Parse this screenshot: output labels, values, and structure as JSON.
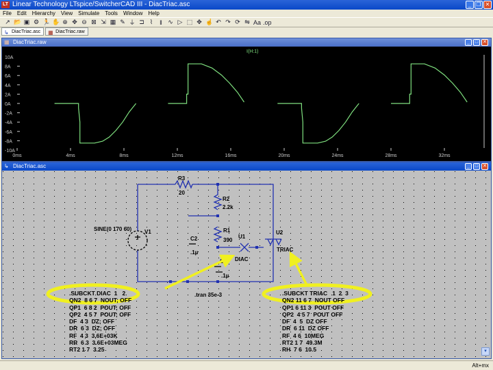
{
  "app": {
    "title": "Linear Technology LTspice/SwitcherCAD III - DiacTriac.asc",
    "icon_label": "LT",
    "window_buttons": [
      "_",
      "❐",
      "✕"
    ]
  },
  "menu": [
    "File",
    "Edit",
    "Hierarchy",
    "View",
    "Simulate",
    "Tools",
    "Window",
    "Help"
  ],
  "toolbar": [
    "new-schematic",
    "open",
    "save",
    "control-panel",
    "run",
    "halt",
    "zoom-in",
    "pan",
    "zoom-out",
    "zoom-fit",
    "autoscale",
    "grid",
    "wire",
    "ground",
    "label",
    "resistor",
    "capacitor",
    "inductor",
    "diode",
    "component",
    "move",
    "drag",
    "undo",
    "redo",
    "rotate",
    "mirror",
    "text",
    "spice-directive"
  ],
  "tabs": [
    {
      "label": "DiacTriac.asc",
      "icon": "schematic-icon",
      "active": true
    },
    {
      "label": "DiacTriac.raw",
      "icon": "waveform-icon",
      "active": false
    }
  ],
  "plot_window": {
    "title": "DiacTriac.raw"
  },
  "schematic_window": {
    "title": "DiacTriac.asc"
  },
  "chart_data": {
    "type": "line",
    "title": "",
    "legend": [
      "I(H:1)"
    ],
    "legend_placement": "top-center",
    "xlabel": "",
    "ylabel": "",
    "xlim": [
      0,
      32
    ],
    "ylim": [
      -10,
      10
    ],
    "x_ticks": [
      "0ms",
      "4ms",
      "8ms",
      "12ms",
      "16ms",
      "20ms",
      "24ms",
      "28ms",
      "32ms"
    ],
    "y_ticks": [
      "10A",
      "8A",
      "6A",
      "4A",
      "2A",
      "0A",
      "-2A",
      "-4A",
      "-6A",
      "-8A",
      "-10A"
    ],
    "color": "#7fe07f",
    "segments": [
      [
        [
          2.8,
          0
        ],
        [
          4.6,
          0
        ],
        [
          4.6,
          -1
        ],
        [
          4.7,
          -4
        ],
        [
          4.7,
          -8.5
        ],
        [
          5.8,
          -8.5
        ],
        [
          6.4,
          -8.1
        ],
        [
          6.9,
          -7.2
        ],
        [
          7.4,
          -5.8
        ],
        [
          7.9,
          -4
        ],
        [
          8.4,
          -1.8
        ],
        [
          8.9,
          0
        ]
      ],
      [
        [
          11.3,
          0
        ],
        [
          12.7,
          0
        ],
        [
          12.7,
          2
        ],
        [
          12.8,
          2
        ],
        [
          12.8,
          8.5
        ],
        [
          13.8,
          8.5
        ],
        [
          14.6,
          7.6
        ],
        [
          15.3,
          6.1
        ],
        [
          15.9,
          4.4
        ],
        [
          16.5,
          2.4
        ],
        [
          17.0,
          0.3
        ]
      ],
      [
        [
          19.5,
          0
        ],
        [
          21.3,
          0
        ],
        [
          21.3,
          -1
        ],
        [
          21.4,
          -4
        ],
        [
          21.4,
          -8.5
        ],
        [
          22.5,
          -8.5
        ],
        [
          23.1,
          -8.1
        ],
        [
          23.6,
          -7.2
        ],
        [
          24.1,
          -5.8
        ],
        [
          24.6,
          -4
        ],
        [
          25.1,
          -1.8
        ],
        [
          25.6,
          0
        ]
      ],
      [
        [
          28.0,
          0
        ],
        [
          29.4,
          0
        ],
        [
          29.4,
          2
        ],
        [
          29.5,
          2
        ],
        [
          29.5,
          8.5
        ],
        [
          30.5,
          8.5
        ],
        [
          31.3,
          7.6
        ],
        [
          32.0,
          6.1
        ],
        [
          32.6,
          4.4
        ],
        [
          33.2,
          2.4
        ],
        [
          33.7,
          0.3
        ]
      ]
    ]
  },
  "schematic": {
    "labels": {
      "r3": "R3",
      "r3_val": "20",
      "r2": "R2",
      "r2_val": "2.2k",
      "r1": "R1",
      "r1_val": "390",
      "c2": "C2",
      "c2_val": ".1µ",
      "c1": "C1",
      "c1_val": ".1µ",
      "v1": "V1",
      "v1_val": "SINE(0 170 60)",
      "u1": "U1",
      "u1_val": "DIAC",
      "u2": "U2",
      "u2_val": "TRIAC",
      "tran": ".tran 35e-3"
    },
    "diac_subckt": [
      ".SUBCKT DIAC  1   2",
      "QN2  8 6 7  NOUT; OFF",
      "QP1  6 8 2  POUT; OFF",
      "QP2  4 5 7  POUT; OFF",
      "DF  4 3  DZ; OFF",
      "DR  6 3  DZ; OFF",
      "RF  4 3  3.6E+03K",
      "RR  6 3  3.6E+03MEG",
      "RT2 1 7  3.25"
    ],
    "triac_subckt": [
      ".SUBCKT TRIAC   1  2  3",
      "QN2 11 6 7  NOUT OFF",
      "QP1 6 11 3  POUT OFF",
      "QP2  4 5 7  POUT OFF",
      "DF  4  5  DZ OFF",
      "DR  6 11  DZ OFF",
      "RF  4 6  10MEG",
      "RT2 1 7  49.3M",
      "RH  7 6  10.5"
    ],
    "highlight_color": "#f0f020"
  },
  "status": {
    "text": "Alt+mx"
  }
}
